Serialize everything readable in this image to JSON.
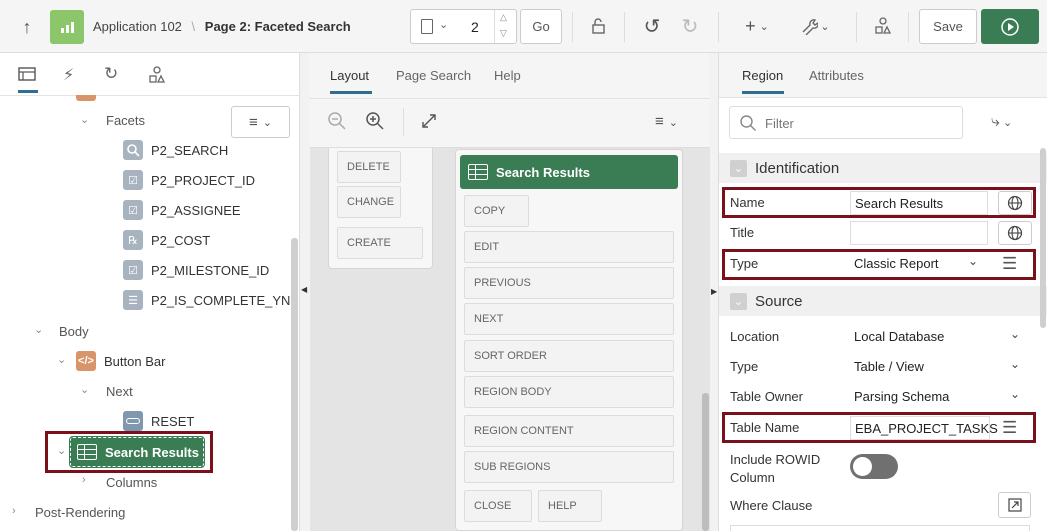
{
  "toolbar": {
    "app_name": "Application 102",
    "page_name": "Page 2: Faceted Search",
    "page_number": "2",
    "go_label": "Go",
    "save_label": "Save"
  },
  "left": {
    "tree": {
      "facets_label": "Facets",
      "items": [
        "P2_SEARCH",
        "P2_PROJECT_ID",
        "P2_ASSIGNEE",
        "P2_COST",
        "P2_MILESTONE_ID",
        "P2_IS_COMPLETE_YN"
      ],
      "body_label": "Body",
      "button_bar_label": "Button Bar",
      "next_label": "Next",
      "reset_label": "RESET",
      "search_results_label": "Search Results",
      "columns_label": "Columns",
      "post_rendering_label": "Post-Rendering"
    }
  },
  "middle": {
    "tabs": [
      "Layout",
      "Page Search",
      "Help"
    ],
    "left_card_buttons": [
      "DELETE",
      "CHANGE",
      "CREATE"
    ],
    "region_title": "Search Results",
    "positions": [
      "COPY",
      "EDIT",
      "PREVIOUS",
      "NEXT",
      "SORT ORDER",
      "REGION BODY",
      "REGION CONTENT",
      "SUB REGIONS"
    ],
    "close_label": "CLOSE",
    "help_label": "HELP"
  },
  "right": {
    "tabs": [
      "Region",
      "Attributes"
    ],
    "filter_placeholder": "Filter",
    "identification": {
      "header": "Identification",
      "name_label": "Name",
      "name_value": "Search Results",
      "title_label": "Title",
      "title_value": "",
      "type_label": "Type",
      "type_value": "Classic Report"
    },
    "source": {
      "header": "Source",
      "location_label": "Location",
      "location_value": "Local Database",
      "type_label": "Type",
      "type_value": "Table / View",
      "owner_label": "Table Owner",
      "owner_value": "Parsing Schema",
      "table_label": "Table Name",
      "table_value": "EBA_PROJECT_TASKS",
      "rowid_label_1": "Include ROWID",
      "rowid_label_2": "Column",
      "where_label": "Where Clause"
    }
  },
  "colors": {
    "accent_green": "#3a7d54",
    "highlight": "#7a1019",
    "active_tab": "#2e6e8e"
  }
}
